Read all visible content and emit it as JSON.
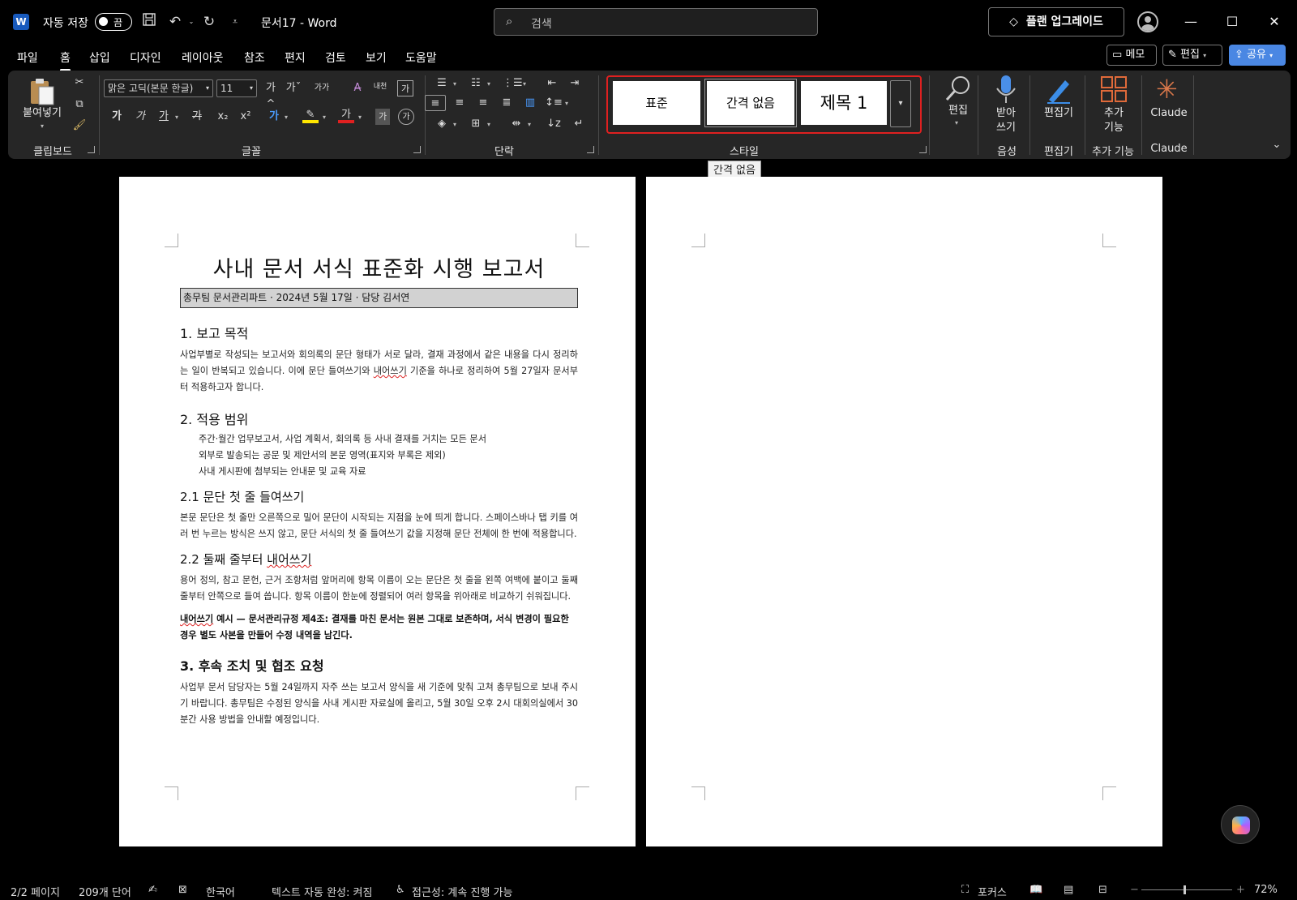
{
  "titlebar": {
    "autosave_label": "자동 저장",
    "autosave_state": "끔",
    "document_title": "문서17  -  Word",
    "search_placeholder": "검색",
    "upgrade_label": "플랜 업그레이드"
  },
  "menu": {
    "tabs": [
      "파일",
      "홈",
      "삽입",
      "디자인",
      "레이아웃",
      "참조",
      "편지",
      "검토",
      "보기",
      "도움말"
    ],
    "active_tab": "홈",
    "memo_label": "메모",
    "edit_label": "편집",
    "share_label": "공유"
  },
  "ribbon": {
    "clipboard": {
      "paste_label": "붙여넣기",
      "group_label": "클립보드"
    },
    "font": {
      "font_name": "맑은 고딕(본문 한글)",
      "font_size": "11",
      "group_label": "글꼴",
      "bold_glyph": "가",
      "italic_glyph": "가",
      "underline_glyph": "가",
      "strike_glyph": "가",
      "sub_glyph": "x₂",
      "sup_glyph": "x²",
      "grow_glyph": "가^",
      "shrink_glyph": "가ˇ",
      "case_glyph": "가가",
      "phonetic_glyph": "내천",
      "color_glyph": "가"
    },
    "paragraph": {
      "group_label": "단락"
    },
    "styles": {
      "group_label": "스타일",
      "tiles": [
        "표준",
        "간격 없음",
        "제목 1"
      ]
    },
    "editing": {
      "label": "편집",
      "group_label": ""
    },
    "voice": {
      "label": "받아\n쓰기",
      "group_label": "음성"
    },
    "editor": {
      "label": "편집기",
      "group_label": "편집기"
    },
    "addins": {
      "label": "추가\n기능",
      "group_label": "추가 기능"
    },
    "claude": {
      "label": "Claude",
      "group_label": "Claude"
    }
  },
  "tooltip": "간격 없음",
  "document": {
    "title": "사내 문서 서식 표준화 시행 보고서",
    "meta": "총무팀 문서관리파트 · 2024년 5월 17일 · 담당 김서연",
    "s1_heading": "1. 보고 목적",
    "s1_para_a": "사업부별로 작성되는 보고서와 회의록의 문단 형태가 서로 달라, 결재 과정에서 같은 내용을 다시 정리하는 일이 반복되고 있습니다. 이에 문단 들여쓰기와 ",
    "s1_para_squig": "내어쓰기",
    "s1_para_b": " 기준을 하나로 정리하여 5월 27일자 문서부터 적용하고자 합니다.",
    "s2_heading": "2. 적용 범위",
    "s2_items": [
      "주간·월간 업무보고서, 사업 계획서, 회의록 등 사내 결재를 거치는 모든 문서",
      "외부로 발송되는 공문 및 제안서의 본문 영역(표지와 부록은 제외)",
      "사내 게시판에 첨부되는 안내문 및 교육 자료"
    ],
    "s21_heading": "2.1 문단 첫 줄 들여쓰기",
    "s21_para": "본문 문단은 첫 줄만 오른쪽으로 밀어 문단이 시작되는 지점을 눈에 띄게 합니다. 스페이스바나 탭 키를 여러 번 누르는 방식은 쓰지 않고, 문단 서식의 첫 줄 들여쓰기 값을 지정해 문단 전체에 한 번에 적용합니다.",
    "s22_heading_a": "2.2 둘째 줄부터 ",
    "s22_heading_squig": "내어쓰기",
    "s22_para": "용어 정의, 참고 문헌, 근거 조항처럼 앞머리에 항목 이름이 오는 문단은 첫 줄을 왼쪽 여백에 붙이고 둘째 줄부터 안쪽으로 들여 씁니다. 항목 이름이 한눈에 정렬되어 여러 항목을 위아래로 비교하기 쉬워집니다.",
    "example_squig": "내어쓰기",
    "example_rest": " 예시 — 문서관리규정 제4조: 결재를 마친 문서는 원본 그대로 보존하며, 서식 변경이 필요한 경우 별도 사본을 만들어 수정 내역을 남긴다.",
    "s3_heading": "3. 후속 조치 및 협조 요청",
    "s3_para": "사업부 문서 담당자는 5월 24일까지 자주 쓰는 보고서 양식을 새 기준에 맞춰 고쳐 총무팀으로 보내 주시기 바랍니다. 총무팀은 수정된 양식을 사내 게시판 자료실에 올리고, 5월 30일 오후 2시 대회의실에서 30분간 사용 방법을 안내할 예정입니다."
  },
  "statusbar": {
    "page": "2/2 페이지",
    "words": "209개 단어",
    "language": "한국어",
    "autocomplete": "텍스트 자동 완성: 켜짐",
    "accessibility": "접근성: 계속 진행 가능",
    "focus": "포커스",
    "zoom": "72%"
  }
}
